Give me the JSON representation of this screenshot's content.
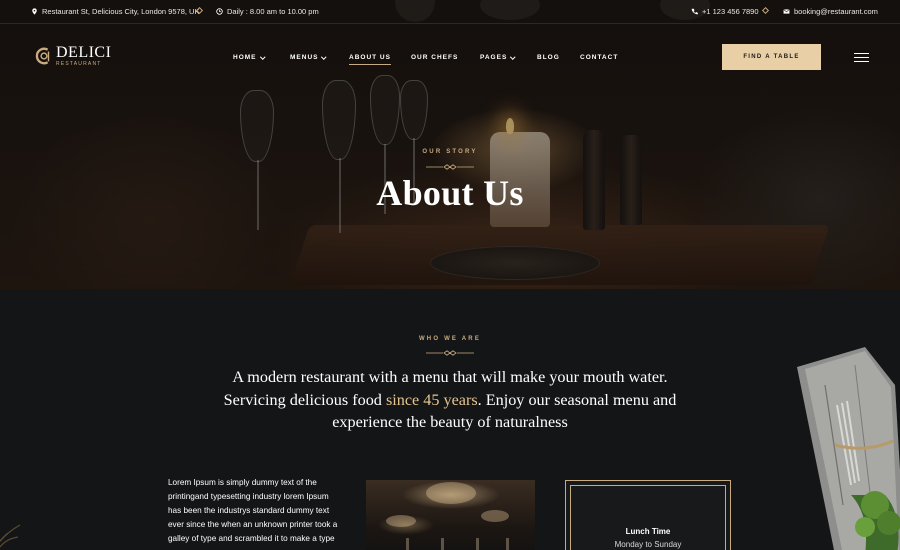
{
  "topbar": {
    "address": "Restaurant St, Delicious City, London 9578, UK",
    "hours": "Daily : 8.00 am to 10.00 pm",
    "phone": "+1 123 456 7890",
    "email": "booking@restaurant.com"
  },
  "brand": {
    "name": "DELICI",
    "sub": "RESTAURANT"
  },
  "nav": {
    "items": [
      {
        "label": "HOME"
      },
      {
        "label": "MENUS"
      },
      {
        "label": "ABOUT US"
      },
      {
        "label": "OUR CHEFS"
      },
      {
        "label": "PAGES"
      },
      {
        "label": "BLOG"
      },
      {
        "label": "CONTACT"
      }
    ],
    "cta": "FIND A TABLE"
  },
  "hero": {
    "eyebrow": "OUR STORY",
    "title": "About Us"
  },
  "intro": {
    "eyebrow": "WHO WE ARE",
    "text_before": "A modern restaurant with a menu that will make your mouth water. Servicing delicious food ",
    "highlight": "since 45 years",
    "text_after": ". Enjoy our seasonal menu and experience the beauty of naturalness"
  },
  "column_text": "Lorem Ipsum is simply dummy text of the printingand typesetting industry lorem Ipsum has been the industrys standard dummy text ever since the when an unknown printer took a galley of type and scrambled it to make a type",
  "hours_card": {
    "title": "Lunch Time",
    "days": "Monday to Sunday"
  },
  "colors": {
    "gold": "#c9ab81",
    "button_bg": "#e8cfa6",
    "background": "#141516",
    "highlight": "#e4c590"
  }
}
